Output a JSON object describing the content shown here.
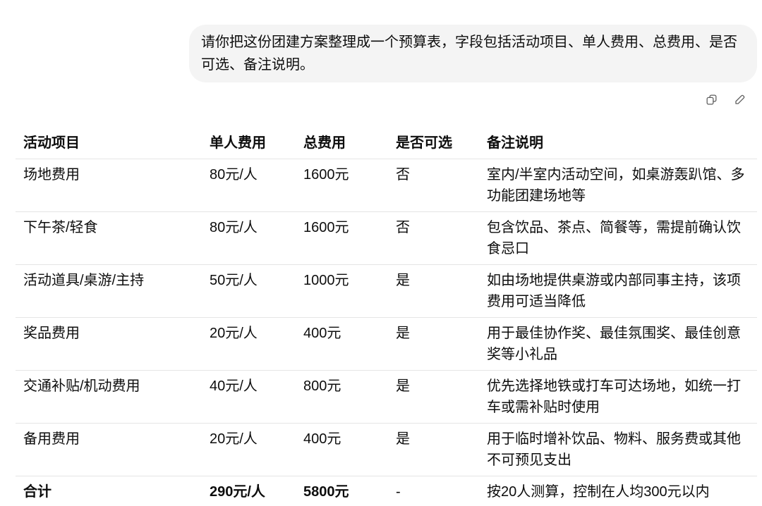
{
  "user_message": {
    "text": "请你把这份团建方案整理成一个预算表，字段包括活动项目、单人费用、总费用、是否可选、备注说明。"
  },
  "message_actions": {
    "icons": [
      "copy-icon",
      "edit-icon"
    ]
  },
  "budget_table": {
    "columns": [
      "活动项目",
      "单人费用",
      "总费用",
      "是否可选",
      "备注说明"
    ],
    "rows": [
      {
        "item": "场地费用",
        "per_person": "80元/人",
        "total": "1600元",
        "optional": "否",
        "note": "室内/半室内活动空间，如桌游轰趴馆、多功能团建场地等"
      },
      {
        "item": "下午茶/轻食",
        "per_person": "80元/人",
        "total": "1600元",
        "optional": "否",
        "note": "包含饮品、茶点、简餐等，需提前确认饮食忌口"
      },
      {
        "item": "活动道具/桌游/主持",
        "per_person": "50元/人",
        "total": "1000元",
        "optional": "是",
        "note": "如由场地提供桌游或内部同事主持，该项费用可适当降低"
      },
      {
        "item": "奖品费用",
        "per_person": "20元/人",
        "total": "400元",
        "optional": "是",
        "note": "用于最佳协作奖、最佳氛围奖、最佳创意奖等小礼品"
      },
      {
        "item": "交通补贴/机动费用",
        "per_person": "40元/人",
        "total": "800元",
        "optional": "是",
        "note": "优先选择地铁或打车可达场地，如统一打车或需补贴时使用"
      },
      {
        "item": "备用费用",
        "per_person": "20元/人",
        "total": "400元",
        "optional": "是",
        "note": "用于临时增补饮品、物料、服务费或其他不可预见支出"
      }
    ],
    "total_row": {
      "item": "合计",
      "per_person": "290元/人",
      "total": "5800元",
      "optional": "-",
      "note": "按20人测算，控制在人均300元以内"
    }
  },
  "colors": {
    "text": "#0d0d0d",
    "bubble_background": "#f4f4f4",
    "icon": "#5d5d5d",
    "table_border": "#e5e5e5"
  }
}
